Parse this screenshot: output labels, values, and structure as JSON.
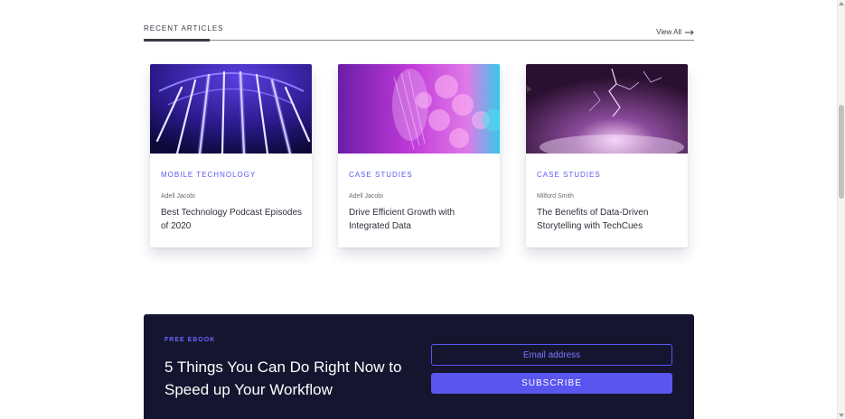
{
  "section": {
    "title": "RECENT ARTICLES",
    "view_all_label": "View All"
  },
  "articles": [
    {
      "category": "MOBILE TECHNOLOGY",
      "author": "Adell Jacobi",
      "title": "Best Technology Podcast Episodes of 2020"
    },
    {
      "category": "CASE STUDIES",
      "author": "Adell Jacobi",
      "title": "Drive Efficient Growth with Integrated Data"
    },
    {
      "category": "CASE STUDIES",
      "author": "Milford Smith",
      "title": "The Benefits of Data-Driven Storytelling with TechCues"
    }
  ],
  "newsletter": {
    "eyebrow": "FREE EBOOK",
    "heading": "5 Things You Can Do Right Now to Speed up Your Workflow",
    "email_placeholder": "Email address",
    "button_label": "SUBSCRIBE"
  },
  "colors": {
    "accent": "#5b55f0",
    "newsletter_bg": "#151530",
    "text_dark": "#2f2f3a"
  }
}
